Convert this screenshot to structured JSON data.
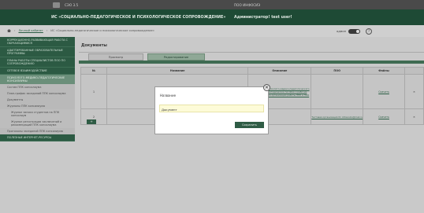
{
  "header": {
    "system_name": "СЭО 3.5",
    "organization": "ПОО ИНФОСИЭ",
    "app_title": "ИС «СОЦИАЛЬНО-ПЕДАГОГИЧЕСКОЕ И ПСИХОЛОГИЧЕСКОЕ СОПРОВОЖДЕНИЕ»",
    "user": "Администратор! test user!"
  },
  "breadcrumb": {
    "items": [
      "Личный кабинет",
      "ИС «Социально-педагогическое и психологическое сопровождение»"
    ]
  },
  "mode": {
    "label": "админ"
  },
  "help_glyph": "?",
  "sidebar": {
    "items": [
      {
        "label": "КОРРЕКЦИОННО-РАЗВИВАЮЩАЯ РАБОТА С ОБУЧАЮЩИМИСЯ",
        "style": "dark"
      },
      {
        "label": "АДАПТИРОВАННЫЕ ОБРАЗОВАТЕЛЬНЫЕ ПРОГРАММЫ",
        "style": "dark"
      },
      {
        "label": "ПЛАНЫ РАБОТЫ СПЕЦИАЛИСТОВ ПОО ПО СОПРОВОЖДЕНИЮ",
        "style": "dark"
      },
      {
        "label": "СЕТЕВОЕ ВЗАИМОДЕЙСТВИЕ",
        "style": "dark"
      },
      {
        "label": "ПСИХОЛОГО-МЕДИКО-ПЕДАГОГИЧЕСКИЕ КОНСИЛИУМЫ",
        "style": "mid"
      },
      {
        "label": "Состав ППК консилиума",
        "style": "light"
      },
      {
        "label": "План-график заседаний ППК консилиума",
        "style": "light"
      },
      {
        "label": "Документы",
        "style": "light"
      },
      {
        "label": "Журналы ППК консилиума",
        "style": "light"
      },
      {
        "label": "Журнал записи студентов на ППК консилиум",
        "style": "sub"
      },
      {
        "label": "Журнал регистрации заключений и рекомендаций ППК консилиума",
        "style": "sub"
      },
      {
        "label": "Протоколы заседаний ППК консилиума",
        "style": "light"
      },
      {
        "label": "ПОЛЕЗНЫЕ ИНТЕРНЕТ-РЕСУРСЫ",
        "style": "dark"
      }
    ]
  },
  "main": {
    "title": "Документы",
    "tabs": [
      {
        "label": "Просмотр"
      },
      {
        "label": "Редактирование"
      }
    ],
    "table": {
      "headers": [
        "№",
        "Название",
        "Описание",
        "ПОО",
        "Файлы",
        ""
      ],
      "rows": [
        {
          "num": "1",
          "name": "",
          "description": "Рабочая книга психолого-медико-педагогического консилиума: методическое пособие и рабочие инструменты для организации работы ППК в ПОО",
          "poo": "",
          "files": "Скачать",
          "delete": "✕"
        },
        {
          "num": "2",
          "name": "",
          "description": "",
          "poo": "Тестовая организация 01 infosoubo@mail.ru",
          "files": "Скачать",
          "delete": "✕"
        }
      ]
    },
    "add_button": "+"
  },
  "modal": {
    "label": "Название",
    "value": "Документ",
    "save": "Сохранить",
    "close": "✕"
  }
}
